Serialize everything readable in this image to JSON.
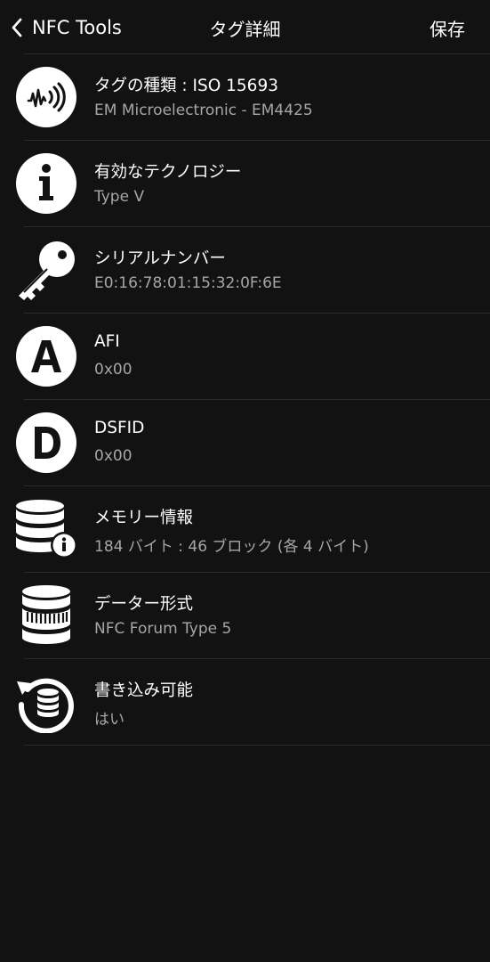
{
  "nav": {
    "back_label": "NFC Tools",
    "title": "タグ詳細",
    "save_label": "保存"
  },
  "items": [
    {
      "icon": "nfc-tag-icon",
      "title": "タグの種類 : ISO 15693",
      "subtitle": "EM Microelectronic - EM4425"
    },
    {
      "icon": "info-icon",
      "title": "有効なテクノロジー",
      "subtitle": "Type V"
    },
    {
      "icon": "key-icon",
      "title": "シリアルナンバー",
      "subtitle": "E0:16:78:01:15:32:0F:6E"
    },
    {
      "icon": "letter-a-icon",
      "title": "AFI",
      "subtitle": "0x00"
    },
    {
      "icon": "letter-d-icon",
      "title": "DSFID",
      "subtitle": "0x00"
    },
    {
      "icon": "database-info-icon",
      "title": "メモリー情報",
      "subtitle": "184 バイト : 46 ブロック (各 4 バイト)"
    },
    {
      "icon": "database-format-icon",
      "title": "データー形式",
      "subtitle": "NFC Forum Type 5"
    },
    {
      "icon": "database-refresh-icon",
      "title": "書き込み可能",
      "subtitle": "はい"
    }
  ]
}
